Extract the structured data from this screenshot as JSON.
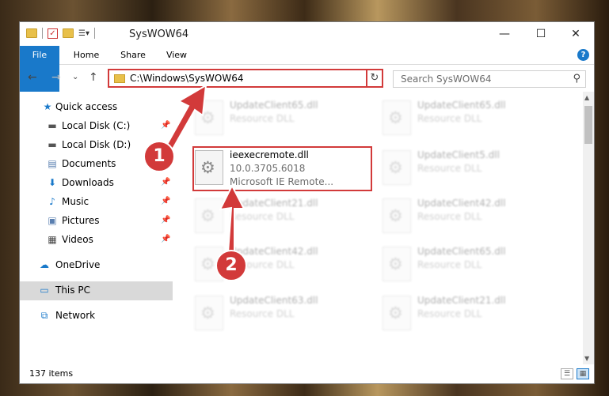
{
  "window": {
    "title": "SysWOW64",
    "minimize": "—",
    "maximize": "☐",
    "close": "✕"
  },
  "ribbon": {
    "tabs": [
      "File",
      "Home",
      "Share",
      "View"
    ],
    "help": "?"
  },
  "navigation": {
    "back": "←",
    "forward": "→",
    "recent": "⌄",
    "up": "↑",
    "address": "C:\\Windows\\SysWOW64",
    "refresh": "↻",
    "search_placeholder": "Search SysWOW64"
  },
  "sidebar": {
    "items": [
      {
        "label": "Quick access",
        "icon": "star-icon"
      },
      {
        "label": "Local Disk (C:)",
        "icon": "drive-icon"
      },
      {
        "label": "Local Disk (D:)",
        "icon": "drive-icon"
      },
      {
        "label": "Documents",
        "icon": "documents-icon"
      },
      {
        "label": "Downloads",
        "icon": "download-icon"
      },
      {
        "label": "Music",
        "icon": "music-icon"
      },
      {
        "label": "Pictures",
        "icon": "pictures-icon"
      },
      {
        "label": "Videos",
        "icon": "videos-icon"
      },
      {
        "label": "OneDrive",
        "icon": "cloud-icon"
      },
      {
        "label": "This PC",
        "icon": "computer-icon"
      },
      {
        "label": "Network",
        "icon": "network-icon"
      }
    ]
  },
  "files": [
    {
      "name": "UpdateClient65.dll",
      "desc": "Resource DLL",
      "dimmed": true
    },
    {
      "name": "UpdateClient65.dll",
      "desc": "Resource DLL",
      "dimmed": true
    },
    {
      "name": "ieexecremote.dll",
      "desc": "10.0.3705.6018",
      "company": "Microsoft IE Remote...",
      "dimmed": false
    },
    {
      "name": "UpdateClient5.dll",
      "desc": "Resource DLL",
      "dimmed": true
    },
    {
      "name": "UpdateClient21.dll",
      "desc": "Resource DLL",
      "dimmed": true
    },
    {
      "name": "UpdateClient42.dll",
      "desc": "Resource DLL",
      "dimmed": true
    },
    {
      "name": "UpdateClient42.dll",
      "desc": "Resource DLL",
      "dimmed": true
    },
    {
      "name": "UpdateClient65.dll",
      "desc": "Resource DLL",
      "dimmed": true
    },
    {
      "name": "UpdateClient63.dll",
      "desc": "Resource DLL",
      "dimmed": true
    },
    {
      "name": "UpdateClient21.dll",
      "desc": "Resource DLL",
      "dimmed": true
    }
  ],
  "status": {
    "count": "137 items"
  },
  "annotations": {
    "step1": "1",
    "step2": "2"
  },
  "colors": {
    "accent": "#1979ca",
    "highlight": "#d23a3a"
  }
}
